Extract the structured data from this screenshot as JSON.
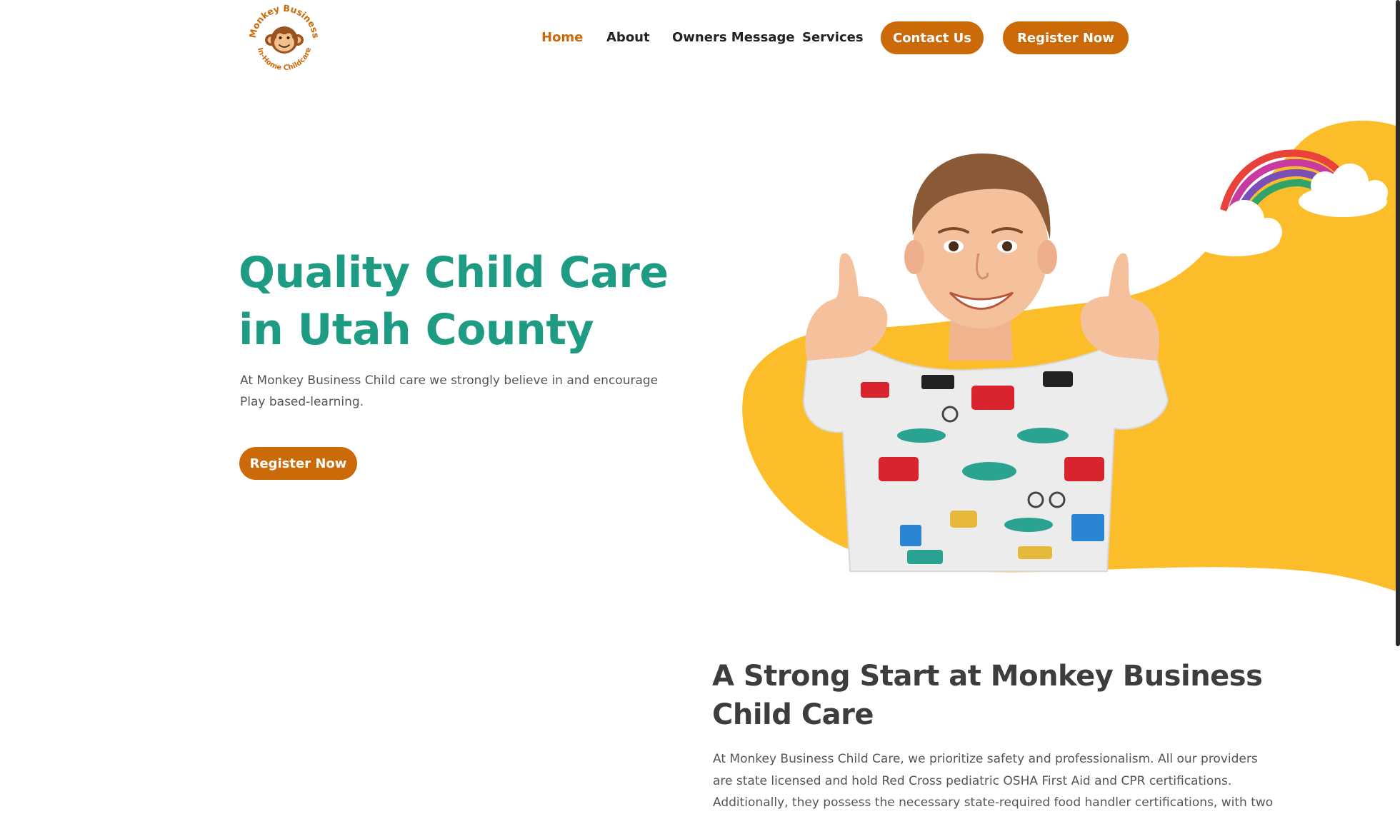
{
  "brand": {
    "logo_text_top": "Monkey Business",
    "logo_text_bottom": "In-Home Childcare",
    "accent_color": "#cc6a0a",
    "heading_color": "#1e9c83",
    "blob_color": "#fbbd2a"
  },
  "nav": {
    "links": [
      "Home",
      "About",
      "Owners Message",
      "Services"
    ],
    "active": "Home",
    "contact_label": "Contact Us",
    "register_label": "Register Now"
  },
  "hero": {
    "title_line1": "Quality Child Care",
    "title_line2": "in Utah County",
    "text": "At  Monkey Business Child care we strongly believe in and encourage Play based-learning.",
    "button_label": "Register Now",
    "image_subject": "smiling boy giving two thumbs up with rainbow and clouds"
  },
  "intro": {
    "title": "A Strong Start at Monkey Business Child Care",
    "text": "At Monkey Business Child Care, we prioritize safety and professionalism. All our providers are state licensed and hold Red Cross pediatric OSHA First Aid and CPR certifications. Additionally, they possess the necessary state-required food handler certifications, with two of our providers"
  }
}
